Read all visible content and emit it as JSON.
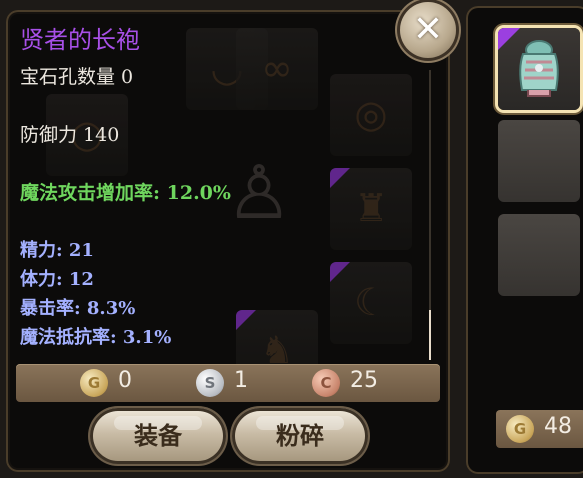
{
  "tooltip": {
    "item_name": "贤者的长袍",
    "socket_line": "宝石孔数量 0",
    "defense_line": "防御力 140",
    "magic_attack_line": "魔法攻击增加率: 12.0%",
    "stats": [
      "精力: 21",
      "体力: 12",
      "暴击率: 8.3%",
      "魔法抵抗率: 3.1%"
    ],
    "scroll_position": 1.0
  },
  "currency": {
    "gold_symbol": "G",
    "gold": "0",
    "silver_symbol": "S",
    "silver": "1",
    "copper_symbol": "C",
    "copper": "25"
  },
  "buttons": {
    "equip": "装备",
    "smash": "粉碎",
    "close_symbol": "✕"
  },
  "side_panel": {
    "gold_symbol": "G",
    "gold": "48"
  },
  "colors": {
    "item_name": "#a850e8",
    "green_stat": "#6fd65e",
    "blue_stat": "#a4b1ff",
    "rarity_corner": "#9b3fe0"
  },
  "icons": [
    "close-icon",
    "gold-coin-icon",
    "silver-coin-icon",
    "copper-coin-icon",
    "robe-armor-icon"
  ]
}
